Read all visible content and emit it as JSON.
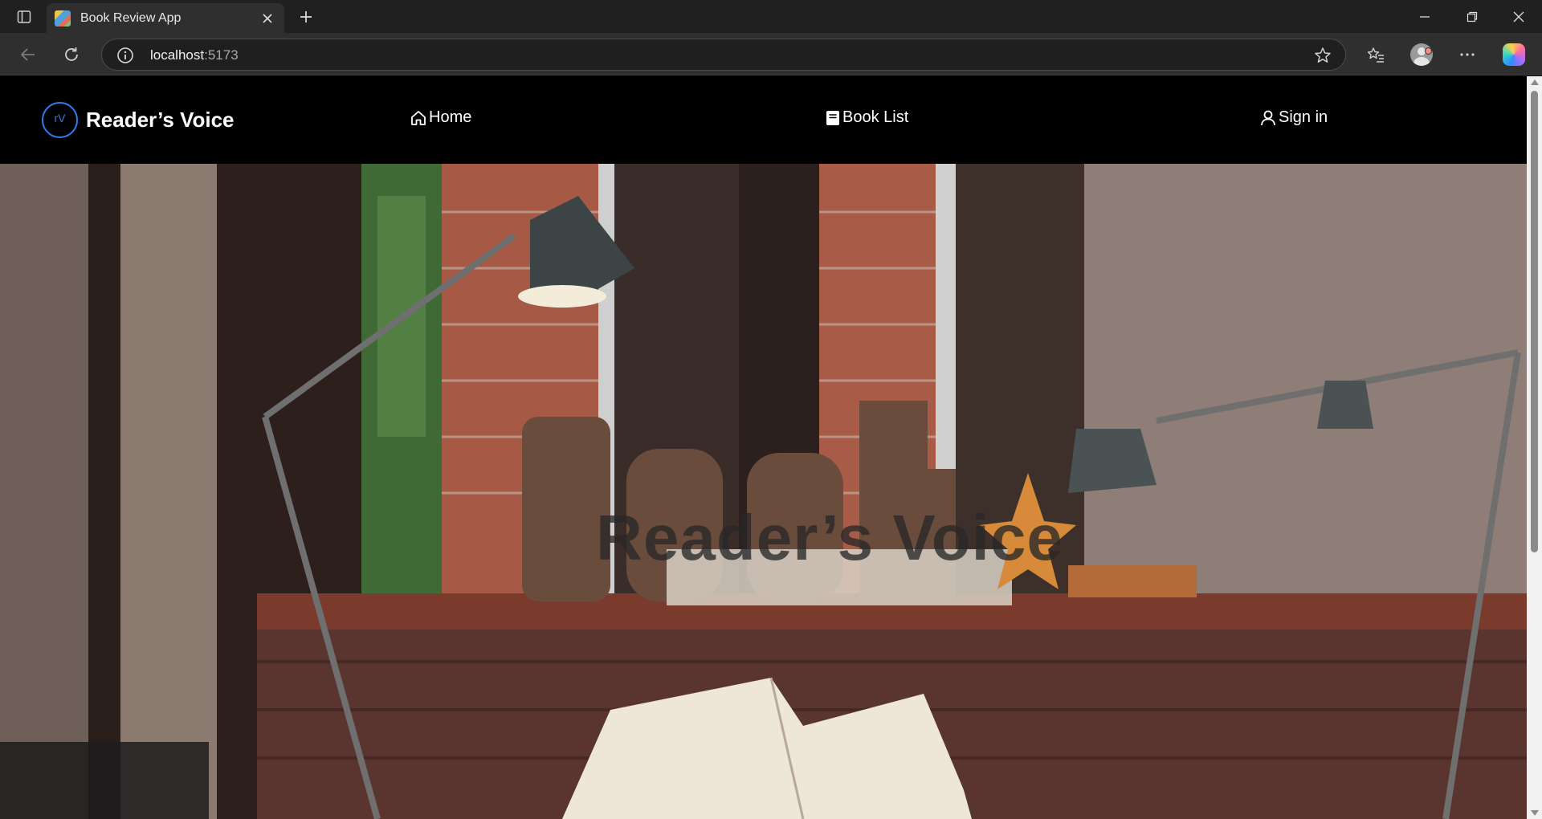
{
  "browser": {
    "tab_title": "Book Review App",
    "url_host": "localhost",
    "url_port": ":5173"
  },
  "site": {
    "brand_logo_text": "rV",
    "brand_name": "Reader’s Voice",
    "nav": {
      "home": "Home",
      "book_list": "Book List",
      "sign_in": "Sign in"
    }
  },
  "hero": {
    "title": "Reader’s Voice"
  }
}
